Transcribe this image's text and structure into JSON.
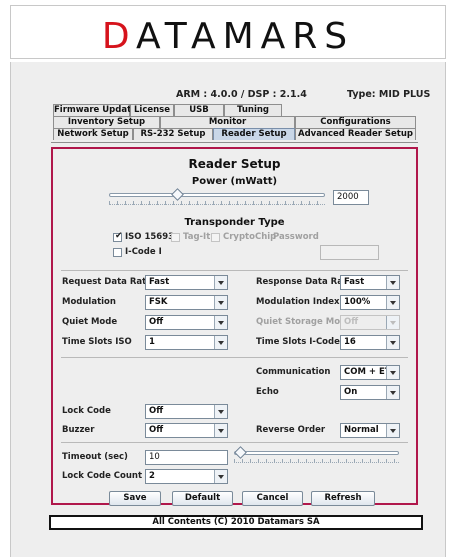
{
  "logo": {
    "text_red": "D",
    "text_rest": "ATAMARS"
  },
  "version": {
    "arm_dsp": "ARM : 4.0.0 / DSP : 2.1.4",
    "type": "Type: MID PLUS"
  },
  "tabs": {
    "row1": [
      "Firmware Update",
      "License",
      "USB",
      "Tuning"
    ],
    "row2": [
      "Inventory Setup",
      "Monitor",
      "Configurations"
    ],
    "row3": [
      "Network Setup",
      "RS-232 Setup",
      "Reader Setup",
      "Advanced Reader Setup"
    ],
    "active": "Reader Setup"
  },
  "panel": {
    "title": "Reader Setup",
    "power": {
      "label": "Power (mWatt)",
      "value": "2000",
      "fraction": 0.32
    },
    "transponder": {
      "title": "Transponder Type",
      "iso15693": {
        "label": "ISO 15693",
        "checked": true
      },
      "tagit": {
        "label": "Tag-It",
        "checked": false
      },
      "cryptochip": {
        "label": "CryptoChip",
        "checked": false
      },
      "password_label": "Password",
      "password_value": "",
      "icodei": {
        "label": "I-Code I",
        "checked": false
      }
    },
    "request_rate": {
      "label": "Request Data Rate",
      "value": "Fast"
    },
    "response_rate": {
      "label": "Response Data Rate",
      "value": "Fast"
    },
    "modulation": {
      "label": "Modulation",
      "value": "FSK"
    },
    "modulation_index": {
      "label": "Modulation Index",
      "value": "100%"
    },
    "quiet_mode": {
      "label": "Quiet Mode",
      "value": "Off"
    },
    "quiet_storage": {
      "label": "Quiet Storage Mode",
      "value": "Off"
    },
    "time_slots_iso": {
      "label": "Time Slots ISO",
      "value": "1"
    },
    "time_slots_icode": {
      "label": "Time Slots I-Code I",
      "value": "16"
    },
    "communication": {
      "label": "Communication",
      "value": "COM + ETH"
    },
    "echo": {
      "label": "Echo",
      "value": "On"
    },
    "lock_code": {
      "label": "Lock Code",
      "value": "Off"
    },
    "buzzer": {
      "label": "Buzzer",
      "value": "Off"
    },
    "reverse_order": {
      "label": "Reverse Order",
      "value": "Normal"
    },
    "timeout": {
      "label": "Timeout (sec)",
      "value": "10",
      "fraction": 0.0
    },
    "lock_code_count": {
      "label": "Lock Code Count",
      "value": "2"
    },
    "buttons": {
      "save": "Save",
      "default": "Default",
      "cancel": "Cancel",
      "refresh": "Refresh"
    }
  },
  "footer": "All Contents (C) 2010 Datamars SA",
  "colors": {
    "accent": "#b0174b",
    "logo_red": "#d6131c",
    "active_tab": "#c9d7e8"
  }
}
